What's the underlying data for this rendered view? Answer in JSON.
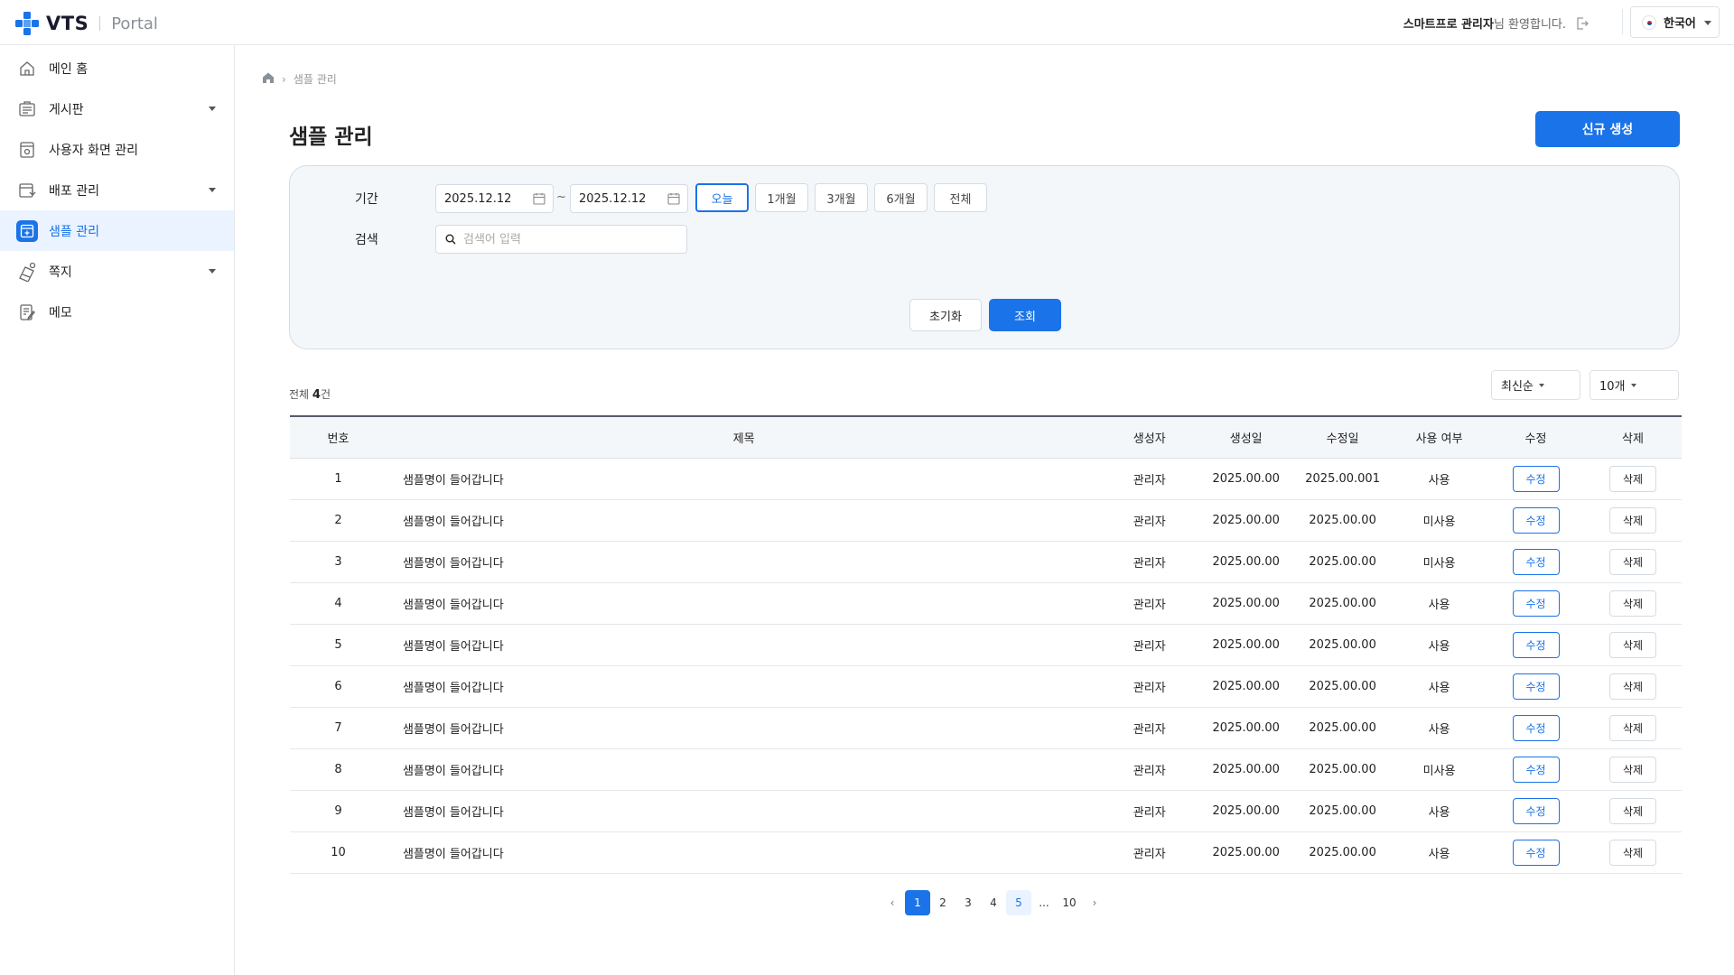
{
  "header": {
    "brand": "VTS",
    "portal": "Portal",
    "welcome_name": "스마트프로 관리자",
    "welcome_suffix": "님 환영합니다.",
    "language": "한국어"
  },
  "sidebar": {
    "items": [
      {
        "label": "메인 홈",
        "icon": "home-icon",
        "has_caret": false,
        "active": false
      },
      {
        "label": "게시판",
        "icon": "board-icon",
        "has_caret": true,
        "active": false
      },
      {
        "label": "사용자 화면 관리",
        "icon": "screen-settings-icon",
        "has_caret": false,
        "active": false
      },
      {
        "label": "배포 관리",
        "icon": "deploy-icon",
        "has_caret": true,
        "active": false
      },
      {
        "label": "샘플 관리",
        "icon": "sample-icon",
        "has_caret": false,
        "active": true
      },
      {
        "label": "쪽지",
        "icon": "message-icon",
        "has_caret": true,
        "active": false
      },
      {
        "label": "메모",
        "icon": "memo-icon",
        "has_caret": false,
        "active": false
      }
    ]
  },
  "breadcrumb": {
    "current": "샘플 관리"
  },
  "page": {
    "title": "샘플 관리",
    "new_button": "신규 생성"
  },
  "filter": {
    "period_label": "기간",
    "start_date": "2025.12.12",
    "tilde": "~",
    "end_date": "2025.12.12",
    "period_buttons": [
      "오늘",
      "1개월",
      "3개월",
      "6개월",
      "전체"
    ],
    "active_period": "오늘",
    "search_label": "검색",
    "search_placeholder": "검색어 입력",
    "reset_button": "초기화",
    "search_button": "조회"
  },
  "list": {
    "total_prefix": "전체",
    "total_count": "4",
    "total_suffix": "건",
    "sort": "최신순",
    "page_size": "10개"
  },
  "table": {
    "headers": [
      "번호",
      "제목",
      "생성자",
      "생성일",
      "수정일",
      "사용 여부",
      "수정",
      "삭제"
    ],
    "edit_label": "수정",
    "delete_label": "삭제",
    "rows": [
      {
        "no": "1",
        "title": "샘플명이 들어갑니다",
        "creator": "관리자",
        "created": "2025.00.00",
        "modified": "2025.00.001",
        "status": "사용"
      },
      {
        "no": "2",
        "title": "샘플명이 들어갑니다",
        "creator": "관리자",
        "created": "2025.00.00",
        "modified": "2025.00.00",
        "status": "미사용"
      },
      {
        "no": "3",
        "title": "샘플명이 들어갑니다",
        "creator": "관리자",
        "created": "2025.00.00",
        "modified": "2025.00.00",
        "status": "미사용"
      },
      {
        "no": "4",
        "title": "샘플명이 들어갑니다",
        "creator": "관리자",
        "created": "2025.00.00",
        "modified": "2025.00.00",
        "status": "사용"
      },
      {
        "no": "5",
        "title": "샘플명이 들어갑니다",
        "creator": "관리자",
        "created": "2025.00.00",
        "modified": "2025.00.00",
        "status": "사용"
      },
      {
        "no": "6",
        "title": "샘플명이 들어갑니다",
        "creator": "관리자",
        "created": "2025.00.00",
        "modified": "2025.00.00",
        "status": "사용"
      },
      {
        "no": "7",
        "title": "샘플명이 들어갑니다",
        "creator": "관리자",
        "created": "2025.00.00",
        "modified": "2025.00.00",
        "status": "사용"
      },
      {
        "no": "8",
        "title": "샘플명이 들어갑니다",
        "creator": "관리자",
        "created": "2025.00.00",
        "modified": "2025.00.00",
        "status": "미사용"
      },
      {
        "no": "9",
        "title": "샘플명이 들어갑니다",
        "creator": "관리자",
        "created": "2025.00.00",
        "modified": "2025.00.00",
        "status": "사용"
      },
      {
        "no": "10",
        "title": "샘플명이 들어갑니다",
        "creator": "관리자",
        "created": "2025.00.00",
        "modified": "2025.00.00",
        "status": "사용"
      }
    ]
  },
  "pagination": {
    "prev": "‹",
    "pages": [
      "1",
      "2",
      "3",
      "4",
      "5"
    ],
    "ellipsis": "...",
    "last": "10",
    "next": "›",
    "current": "1",
    "hovered": "5"
  },
  "colors": {
    "accent": "#1a73e8",
    "active_bg": "#eaf3ff",
    "filter_bg": "#f4f7fa"
  }
}
